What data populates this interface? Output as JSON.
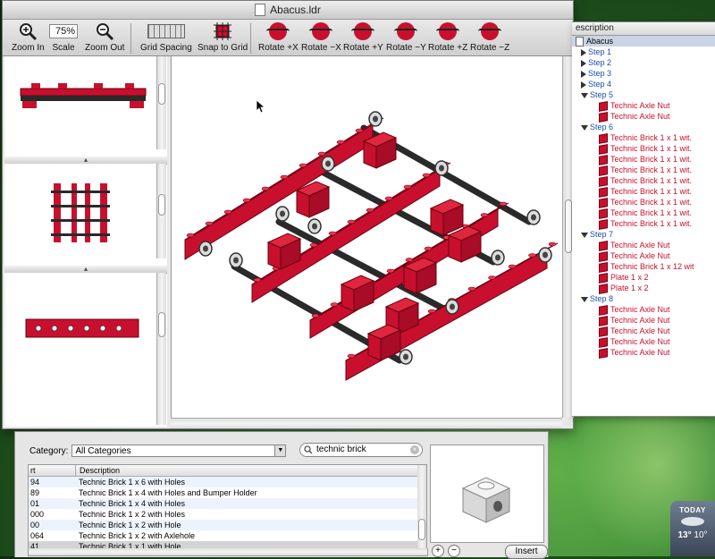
{
  "window": {
    "title": "Abacus.ldr"
  },
  "toolbar": {
    "zoom_in": "Zoom In",
    "scale_label": "Scale",
    "scale_value": "75%",
    "zoom_out": "Zoom Out",
    "grid_spacing": "Grid Spacing",
    "snap_to_grid": "Snap to Grid",
    "rotate": [
      "Rotate +X",
      "Rotate −X",
      "Rotate +Y",
      "Rotate −Y",
      "Rotate +Z",
      "Rotate −Z"
    ]
  },
  "drawer": {
    "header": "escription",
    "rows": [
      {
        "kind": "file",
        "label": "Abacus",
        "selected": true
      },
      {
        "kind": "step",
        "label": "Step 1",
        "open": false
      },
      {
        "kind": "step",
        "label": "Step 2",
        "open": false
      },
      {
        "kind": "step",
        "label": "Step 3",
        "open": false
      },
      {
        "kind": "step",
        "label": "Step 4",
        "open": false
      },
      {
        "kind": "step",
        "label": "Step 5",
        "open": true
      },
      {
        "kind": "part",
        "label": "Technic Axle Nut"
      },
      {
        "kind": "part",
        "label": "Technic Axle Nut"
      },
      {
        "kind": "step",
        "label": "Step 6",
        "open": true
      },
      {
        "kind": "part",
        "label": "Technic Brick  1 x  1 wit."
      },
      {
        "kind": "part",
        "label": "Technic Brick  1 x  1 wit."
      },
      {
        "kind": "part",
        "label": "Technic Brick  1 x  1 wit."
      },
      {
        "kind": "part",
        "label": "Technic Brick  1 x  1 wit."
      },
      {
        "kind": "part",
        "label": "Technic Brick  1 x  1 wit."
      },
      {
        "kind": "part",
        "label": "Technic Brick  1 x  1 wit."
      },
      {
        "kind": "part",
        "label": "Technic Brick  1 x  1 wit."
      },
      {
        "kind": "part",
        "label": "Technic Brick  1 x  1 wit."
      },
      {
        "kind": "part",
        "label": "Technic Brick  1 x  1 wit."
      },
      {
        "kind": "step",
        "label": "Step 7",
        "open": true
      },
      {
        "kind": "part",
        "label": "Technic Axle Nut"
      },
      {
        "kind": "part",
        "label": "Technic Axle Nut"
      },
      {
        "kind": "part",
        "label": "Technic Brick  1 x 12 wit"
      },
      {
        "kind": "part",
        "label": "Plate  1 x  2"
      },
      {
        "kind": "part",
        "label": "Plate  1 x  2"
      },
      {
        "kind": "step",
        "label": "Step 8",
        "open": true
      },
      {
        "kind": "part",
        "label": "Technic Axle Nut"
      },
      {
        "kind": "part",
        "label": "Technic Axle Nut"
      },
      {
        "kind": "part",
        "label": "Technic Axle Nut"
      },
      {
        "kind": "part",
        "label": "Technic Axle Nut"
      },
      {
        "kind": "part",
        "label": "Technic Axle Nut"
      }
    ]
  },
  "browser": {
    "category_label": "Category:",
    "category_value": "All Categories",
    "search_value": "technic brick",
    "columns": [
      "rt",
      "Description"
    ],
    "rows": [
      {
        "part": "94",
        "desc": "Technic Brick  1 x  6 with Holes"
      },
      {
        "part": "89",
        "desc": "Technic Brick  1 x  4 with Holes and Bumper Holder"
      },
      {
        "part": "01",
        "desc": "Technic Brick  1 x  4 with Holes"
      },
      {
        "part": "000",
        "desc": "Technic Brick  1 x  2 with Holes"
      },
      {
        "part": "00",
        "desc": "Technic Brick  1 x  2 with Hole"
      },
      {
        "part": "064",
        "desc": "Technic Brick  1 x  2 with Axlehole"
      },
      {
        "part": "41",
        "desc": "Technic Brick  1 x  1 with Hole",
        "selected": true
      }
    ],
    "insert_label": "Insert",
    "add_label": "+",
    "remove_label": "−"
  },
  "weather": {
    "today": "TODAY",
    "high": "13°",
    "low": "10°"
  },
  "colors": {
    "brick": "#c8102e",
    "axle": "#2a2a2a",
    "step_text": "#1b4ea8",
    "part_text": "#c8102e"
  }
}
